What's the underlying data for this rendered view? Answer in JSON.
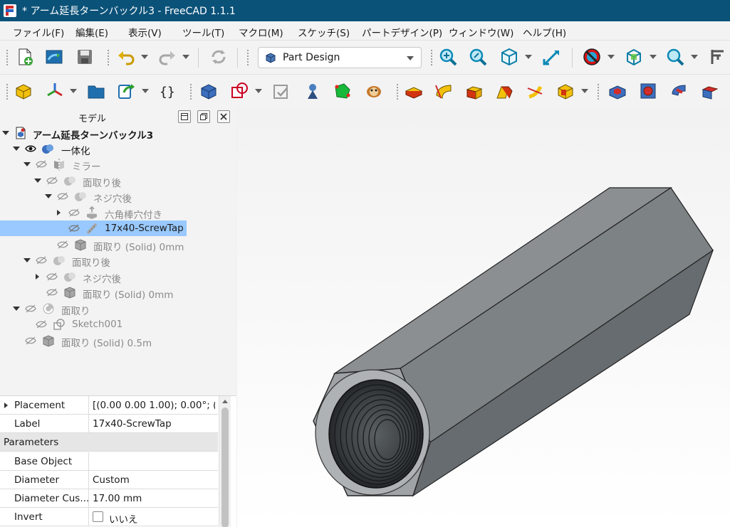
{
  "window": {
    "title": "* アーム延長ターンバックル3 - FreeCAD 1.1.1"
  },
  "menu": {
    "file": "ファイル(F)",
    "edit": "編集(E)",
    "view": "表示(V)",
    "tools": "ツール(T)",
    "macro": "マクロ(M)",
    "sketch": "スケッチ(S)",
    "part_design": "パートデザイン(P)",
    "window": "ウィンドウ(W)",
    "help": "ヘルプ(H)"
  },
  "workbench": {
    "selected": "Part Design"
  },
  "model_panel": {
    "title": "モデル"
  },
  "tree": {
    "document": "アーム延長ターンバックル3",
    "fusion": "一体化",
    "mirror": "ミラー",
    "chamfer_after_1": "面取り後",
    "thread_after_1": "ネジ穴後",
    "hex_bar": "六角棒穴付き",
    "screwtap": "17x40-ScrewTap",
    "chamfer_solid_1": "面取り (Solid) 0mm",
    "chamfer_after_2": "面取り後",
    "thread_after_2": "ネジ穴後",
    "chamfer_solid_2": "面取り (Solid) 0mm",
    "chamfer": "面取り",
    "sketch": "Sketch001",
    "chamfer_solid_3": "面取り (Solid) 0.5m"
  },
  "properties": {
    "placement": {
      "name": "Placement",
      "value": "[(0.00 0.00 1.00); 0.00°; (..."
    },
    "label": {
      "name": "Label",
      "value": "17x40-ScrewTap"
    },
    "group_parameters": "Parameters",
    "base_object": {
      "name": "Base Object",
      "value": ""
    },
    "diameter": {
      "name": "Diameter",
      "value": "Custom"
    },
    "diameter_custom": {
      "name": "Diameter Cus...",
      "value": "17.00 mm"
    },
    "invert": {
      "name": "Invert",
      "value": "いいえ"
    }
  }
}
